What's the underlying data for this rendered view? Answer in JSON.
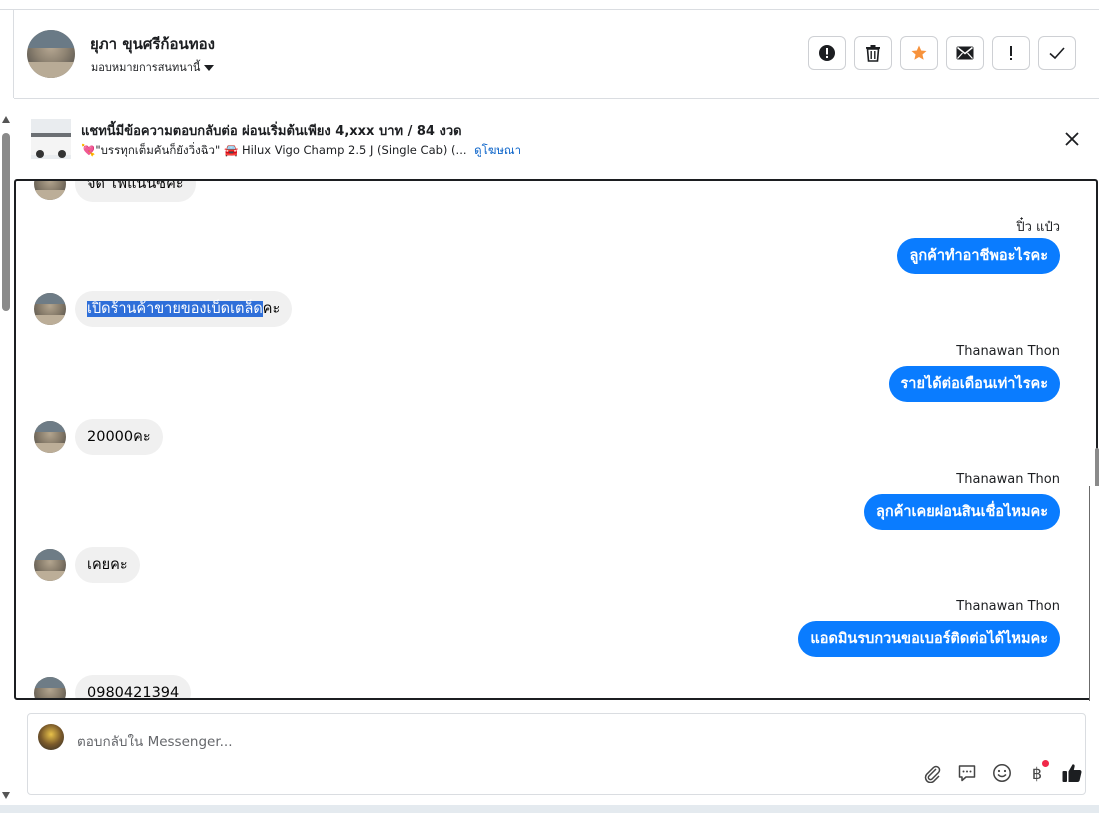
{
  "header": {
    "name": "ยุภา ขุนศรีก้อนทอง",
    "assign_label": "มอบหมายการสนทนานี้",
    "actions": [
      {
        "icon": "alert-circle-icon"
      },
      {
        "icon": "trash-icon"
      },
      {
        "icon": "star-icon",
        "color": "#f7923b"
      },
      {
        "icon": "mail-icon"
      },
      {
        "icon": "exclamation-icon"
      },
      {
        "icon": "check-icon"
      }
    ]
  },
  "ad_banner": {
    "title": "แชทนี้มีข้อความตอบกลับต่อ ผ่อนเริ่มต้นเพียง 4,xxx บาท / 84 งวด",
    "subtitle": "💘\"บรรทุกเต็มคันก็ยังวิ่งฉิว\" 🚘 Hilux Vigo Champ 2.5 J (Single Cab) (...",
    "link": "ดูโฆษณา"
  },
  "messages": {
    "in0": "จัด ไฟแนนซ์คะ",
    "out1_sender": "ปิ๋ว แป๋ว",
    "out1": "ลูกค้าทำอาชีพอะไรคะ",
    "in1_highlight": "เปิดร้านค้าขายของเบ็ดเตล็ด",
    "in1_rest": "คะ",
    "out2_sender": "Thanawan Thon",
    "out2": "รายได้ต่อเดือนเท่าไรคะ",
    "in2": "20000คะ",
    "out3_sender": "Thanawan Thon",
    "out3": "ลุกค้าเคยผ่อนสินเชื่อไหมคะ",
    "in3": "เคยคะ",
    "out4_sender": "Thanawan Thon",
    "out4": "แอดมินรบกวนขอเบอร์ติดต่อได้ไหมคะ",
    "in4": "0980421394"
  },
  "composer": {
    "placeholder": "ตอบกลับใน Messenger...",
    "tools": [
      "paperclip-icon",
      "saved-reply-icon",
      "emoji-icon",
      "baht-icon",
      "thumbs-up-icon"
    ],
    "baht_symbol": "฿",
    "accent": "#0a7cff"
  },
  "colors": {
    "outgoing_bubble": "#0a7cff",
    "incoming_bubble": "#f0f0f0",
    "highlight": "#2f6fd9",
    "link": "#0a63c9"
  }
}
